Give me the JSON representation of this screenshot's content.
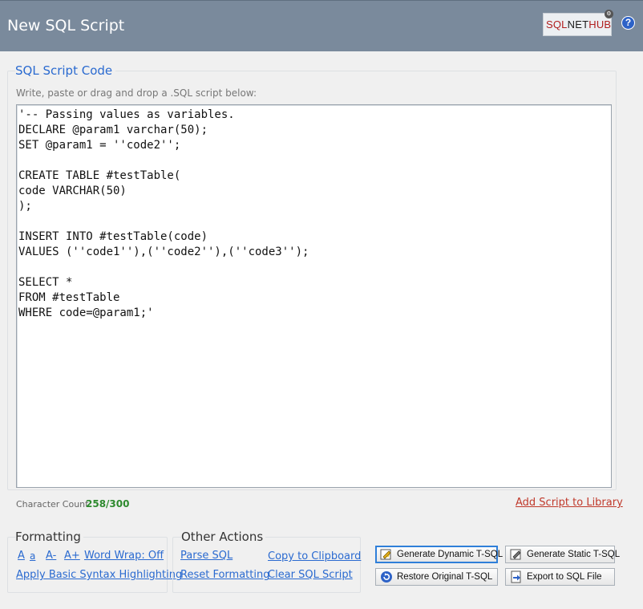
{
  "header": {
    "title": "New SQL Script",
    "logo": {
      "part1": "SQL",
      "part2": "NET",
      "part3": "HUB"
    },
    "help_label": "?"
  },
  "section": {
    "title": "SQL Script Code",
    "instruction": "Write, paste or drag and drop a .SQL script below:"
  },
  "editor": {
    "content": "'-- Passing values as variables.\nDECLARE @param1 varchar(50);\nSET @param1 = ''code2'';\n\nCREATE TABLE #testTable(\ncode VARCHAR(50)\n);\n\nINSERT INTO #testTable(code)\nVALUES (''code1''),(''code2''),(''code3'');\n\nSELECT *\nFROM #testTable\nWHERE code=@param1;'"
  },
  "status": {
    "char_count_label": "Character Count:",
    "char_count_value": "258/300",
    "add_to_library": "Add Script to Library"
  },
  "formatting": {
    "title": "Formatting",
    "font_a_large": "A",
    "font_a_small": "a",
    "font_decrease": "A-",
    "font_increase": "A+",
    "word_wrap": "Word Wrap: Off",
    "syntax_highlighting": "Apply Basic Syntax Highlighting"
  },
  "other_actions": {
    "title": "Other Actions",
    "parse_sql": "Parse SQL",
    "copy_clipboard": "Copy to Clipboard",
    "reset_formatting": "Reset Formatting",
    "clear_script": "Clear SQL Script"
  },
  "buttons": {
    "generate_dynamic": "Generate Dynamic T-SQL",
    "generate_static": "Generate Static T-SQL",
    "restore_original": "Restore Original T-SQL",
    "export_sql": "Export to SQL File"
  },
  "colors": {
    "header_bg": "#7a8a9c",
    "accent_blue": "#2a6ad0",
    "count_green": "#2e8a2e",
    "library_red": "#c0392b"
  }
}
